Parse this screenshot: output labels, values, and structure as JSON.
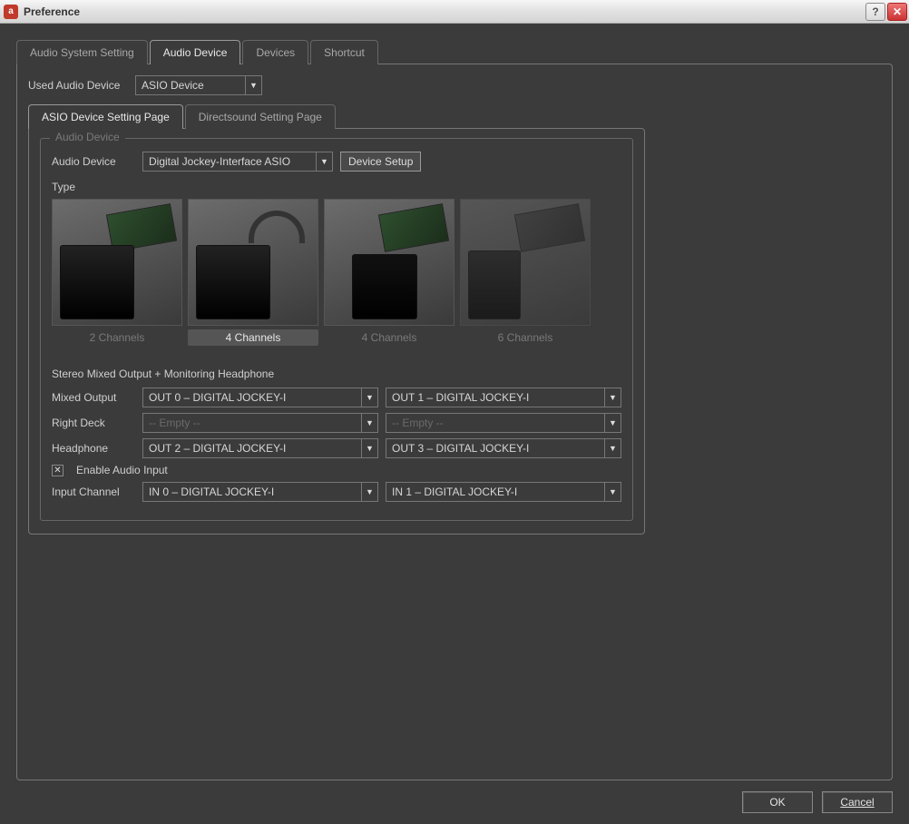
{
  "window": {
    "title": "Preference"
  },
  "tabs_outer": [
    {
      "label": "Audio System Setting"
    },
    {
      "label": "Audio Device"
    },
    {
      "label": "Devices"
    },
    {
      "label": "Shortcut"
    }
  ],
  "used_device": {
    "label": "Used Audio Device",
    "value": "ASIO Device"
  },
  "tabs_inner": [
    {
      "label": "ASIO Device Setting Page"
    },
    {
      "label": "Directsound Setting Page"
    }
  ],
  "fieldset_legend": "Audio Device",
  "audio_device": {
    "label": "Audio Device",
    "value": "Digital Jockey-Interface ASIO",
    "setup_button": "Device Setup"
  },
  "type_label": "Type",
  "types": [
    {
      "caption": "2 Channels"
    },
    {
      "caption": "4 Channels"
    },
    {
      "caption": "4 Channels"
    },
    {
      "caption": "6 Channels"
    }
  ],
  "outputs": {
    "title": "Stereo Mixed Output + Monitoring Headphone",
    "rows": [
      {
        "label": "Mixed Output",
        "left": "OUT 0 – DIGITAL JOCKEY-I",
        "right": "OUT 1 – DIGITAL JOCKEY-I"
      },
      {
        "label": "Right Deck",
        "left": "-- Empty --",
        "right": "-- Empty --",
        "dim": true
      },
      {
        "label": "Headphone",
        "left": "OUT 2 – DIGITAL JOCKEY-I",
        "right": "OUT 3 – DIGITAL JOCKEY-I"
      }
    ],
    "enable_input_label": "Enable Audio Input",
    "input": {
      "label": "Input Channel",
      "left": "IN 0 – DIGITAL JOCKEY-I",
      "right": "IN 1 – DIGITAL JOCKEY-I"
    }
  },
  "footer": {
    "ok": "OK",
    "cancel": "Cancel"
  },
  "glyphs": {
    "down": "▼",
    "check": "✕",
    "close": "✕",
    "help": "?"
  }
}
